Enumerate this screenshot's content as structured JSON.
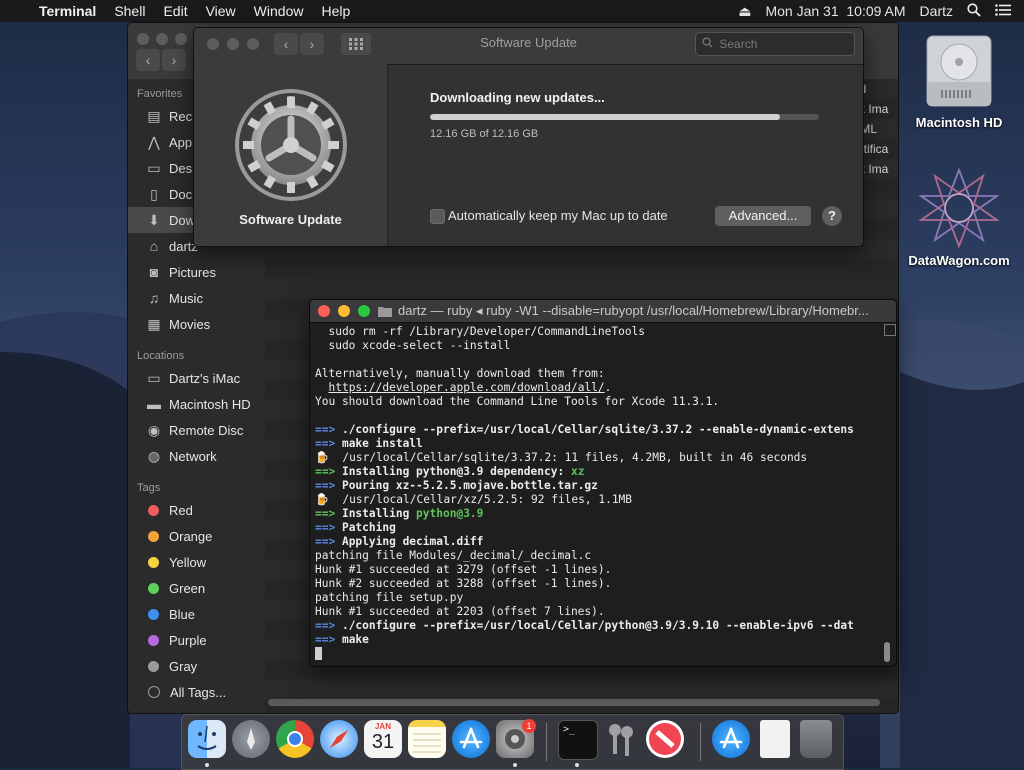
{
  "menubar": {
    "apple": "",
    "app_name": "Terminal",
    "menus": [
      "Shell",
      "Edit",
      "View",
      "Window",
      "Help"
    ],
    "eject": "⏏",
    "datetime": "Mon Jan 31  10:09 AM",
    "user": "Dartz"
  },
  "finder": {
    "favorites_header": "Favorites",
    "favorites": [
      "Rec",
      "App",
      "Des",
      "Doc",
      "Dow",
      "dartz",
      "Pictures",
      "Music",
      "Movies"
    ],
    "locations_header": "Locations",
    "locations": [
      "Dartz's iMac",
      "Macintosh HD",
      "Remote Disc",
      "Network"
    ],
    "tags_header": "Tags",
    "tags": [
      {
        "label": "Red",
        "color": "#ec5f5d"
      },
      {
        "label": "Orange",
        "color": "#f5a23b"
      },
      {
        "label": "Yellow",
        "color": "#f3d33e"
      },
      {
        "label": "Green",
        "color": "#5fcf5a"
      },
      {
        "label": "Blue",
        "color": "#3d8ff1"
      },
      {
        "label": "Purple",
        "color": "#b66ae0"
      },
      {
        "label": "Gray",
        "color": "#9a9a9a"
      }
    ],
    "all_tags": "All Tags...",
    "column_partial": [
      "nd",
      "sk Ima",
      "TML",
      "ertifica",
      "sk Ima"
    ]
  },
  "software_update": {
    "title": "Software Update",
    "search_placeholder": "Search",
    "name": "Software Update",
    "status": "Downloading new updates...",
    "size": "12.16 GB of 12.16 GB",
    "progress": 0.9,
    "auto_update_label": "Automatically keep my Mac up to date",
    "auto_update_checked": false,
    "advanced_button": "Advanced...",
    "help_button": "?"
  },
  "terminal": {
    "title": "dartz — ruby ◂ ruby -W1 --disable=rubyopt /usr/local/Homebrew/Library/Homebr...",
    "lines": [
      {
        "type": "text",
        "text": "  sudo rm -rf /Library/Developer/CommandLineTools"
      },
      {
        "type": "text",
        "text": "  sudo xcode-select --install"
      },
      {
        "type": "text",
        "text": ""
      },
      {
        "type": "text",
        "text": "Alternatively, manually download them from:"
      },
      {
        "type": "link",
        "prefix": "  ",
        "link": "https://developer.apple.com/download/all/",
        "suffix": "."
      },
      {
        "type": "text",
        "text": "You should download the Command Line Tools for Xcode 11.3.1."
      },
      {
        "type": "text",
        "text": ""
      },
      {
        "type": "arrow",
        "arrow": "==>",
        "text": " ./configure --prefix=/usr/local/Cellar/sqlite/3.37.2 --enable-dynamic-extens"
      },
      {
        "type": "arrow",
        "arrow": "==>",
        "text": " make install"
      },
      {
        "type": "beer",
        "icon": "🍺",
        "text": "  /usr/local/Cellar/sqlite/3.37.2: 11 files, 4.2MB, built in 46 seconds"
      },
      {
        "type": "garrow",
        "arrow": "==>",
        "text": " Installing python@3.9 dependency: ",
        "hl": "xz"
      },
      {
        "type": "arrow",
        "arrow": "==>",
        "text": " Pouring xz--5.2.5.mojave.bottle.tar.gz"
      },
      {
        "type": "beer",
        "icon": "🍺",
        "text": "  /usr/local/Cellar/xz/5.2.5: 92 files, 1.1MB"
      },
      {
        "type": "garrow",
        "arrow": "==>",
        "text": " Installing ",
        "hl": "python@3.9"
      },
      {
        "type": "arrow",
        "arrow": "==>",
        "text": " Patching"
      },
      {
        "type": "arrow",
        "arrow": "==>",
        "text": " Applying decimal.diff"
      },
      {
        "type": "text",
        "text": "patching file Modules/_decimal/_decimal.c"
      },
      {
        "type": "text",
        "text": "Hunk #1 succeeded at 3279 (offset -1 lines)."
      },
      {
        "type": "text",
        "text": "Hunk #2 succeeded at 3288 (offset -1 lines)."
      },
      {
        "type": "text",
        "text": "patching file setup.py"
      },
      {
        "type": "text",
        "text": "Hunk #1 succeeded at 2203 (offset 7 lines)."
      },
      {
        "type": "arrow",
        "arrow": "==>",
        "text": " ./configure --prefix=/usr/local/Cellar/python@3.9/3.9.10 --enable-ipv6 --dat"
      },
      {
        "type": "arrow",
        "arrow": "==>",
        "text": " make"
      },
      {
        "type": "cursor"
      }
    ]
  },
  "desktop": {
    "icons": [
      "Macintosh HD",
      "DataWagon.com"
    ]
  },
  "dock": {
    "calendar_month": "JAN",
    "calendar_day": "31",
    "badge_count": "1",
    "apps": [
      "finder-icon",
      "launchpad-icon",
      "chrome-icon",
      "safari-icon",
      "calendar-icon",
      "notes-icon",
      "app-store-icon",
      "system-preferences-icon",
      "terminal-icon",
      "keychain-icon",
      "news-icon",
      "app-store-downloads-icon",
      "document-icon",
      "trash-icon"
    ]
  },
  "colors": {
    "menubar_bg": "#1a1a1c",
    "terminal_arrow": "#5a8ae6",
    "terminal_green": "#5ec45a",
    "close": "#fe5f57",
    "minimize": "#febc2e",
    "zoom": "#28c840"
  }
}
